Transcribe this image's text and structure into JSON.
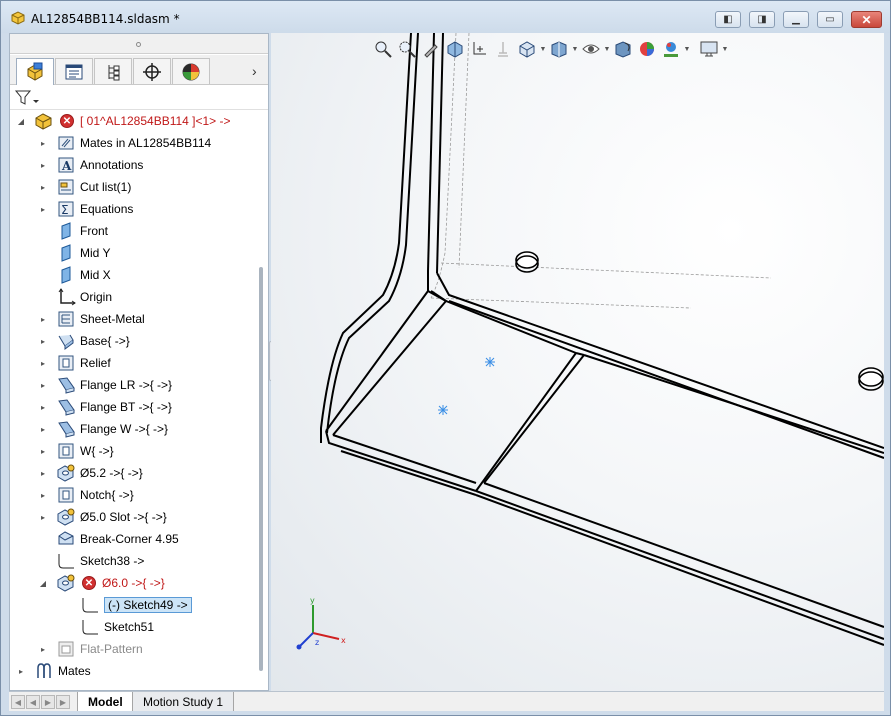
{
  "window": {
    "title": "AL12854BB114.sldasm *",
    "buttons": [
      "restore-left",
      "restore-right",
      "minimize",
      "maximize",
      "close"
    ]
  },
  "panel_tabs": [
    "FeatureManager",
    "PropertyManager",
    "ConfigurationManager",
    "DimXpertManager",
    "DisplayManager"
  ],
  "tree": {
    "root": "[ 01^AL12854BB114 ]<1> ->",
    "items": [
      {
        "label": "Mates in AL12854BB114",
        "icon": "mates-folder-icon",
        "expandable": true
      },
      {
        "label": "Annotations",
        "icon": "annotations-icon",
        "expandable": true
      },
      {
        "label": "Cut list(1)",
        "icon": "cut-list-icon",
        "expandable": true
      },
      {
        "label": "Equations",
        "icon": "equations-icon",
        "expandable": true
      },
      {
        "label": "Front",
        "icon": "plane-icon",
        "expandable": false
      },
      {
        "label": "Mid Y",
        "icon": "plane-icon",
        "expandable": false
      },
      {
        "label": "Mid X",
        "icon": "plane-icon",
        "expandable": false
      },
      {
        "label": "Origin",
        "icon": "origin-icon",
        "expandable": false
      },
      {
        "label": "Sheet-Metal",
        "icon": "sheet-metal-icon",
        "expandable": true
      },
      {
        "label": "Base{ ->}",
        "icon": "base-flange-icon",
        "expandable": true
      },
      {
        "label": "Relief",
        "icon": "relief-icon",
        "expandable": true
      },
      {
        "label": "Flange LR ->{ ->}",
        "icon": "edge-flange-icon",
        "expandable": true
      },
      {
        "label": "Flange BT ->{ ->}",
        "icon": "edge-flange-icon",
        "expandable": true
      },
      {
        "label": "Flange W ->{ ->}",
        "icon": "edge-flange-icon",
        "expandable": true
      },
      {
        "label": "W{ ->}",
        "icon": "cut-extrude-icon",
        "expandable": true
      },
      {
        "label": "Ø5.2 ->{ ->}",
        "icon": "hole-wizard-icon",
        "expandable": true
      },
      {
        "label": "Notch{ ->}",
        "icon": "cut-extrude-icon",
        "expandable": true
      },
      {
        "label": "Ø5.0 Slot ->{ ->}",
        "icon": "hole-wizard-icon",
        "expandable": true
      },
      {
        "label": "Break-Corner 4.95",
        "icon": "break-corner-icon",
        "expandable": false
      },
      {
        "label": "Sketch38 ->",
        "icon": "sketch-icon",
        "expandable": false
      },
      {
        "label": "Ø6.0 ->{ ->}",
        "icon": "hole-wizard-icon",
        "expandable": true,
        "error": true
      }
    ],
    "children": [
      {
        "label": "(-) Sketch49 ->",
        "icon": "sketch-icon",
        "selected": true
      },
      {
        "label": "Sketch51",
        "icon": "sketch-icon",
        "selected": false
      }
    ],
    "flat_pattern": "Flat-Pattern",
    "mates": "Mates"
  },
  "bottom_tabs": {
    "model": "Model",
    "motion": "Motion Study 1"
  },
  "triad": {
    "x": "x",
    "y": "y",
    "z": "z"
  },
  "colors": {
    "error": "#d13030",
    "error_text": "#c01818",
    "selection_fill": "#cce4f7",
    "selection_border": "#5a9ad6",
    "sketch_point": "#3a8ee6"
  }
}
